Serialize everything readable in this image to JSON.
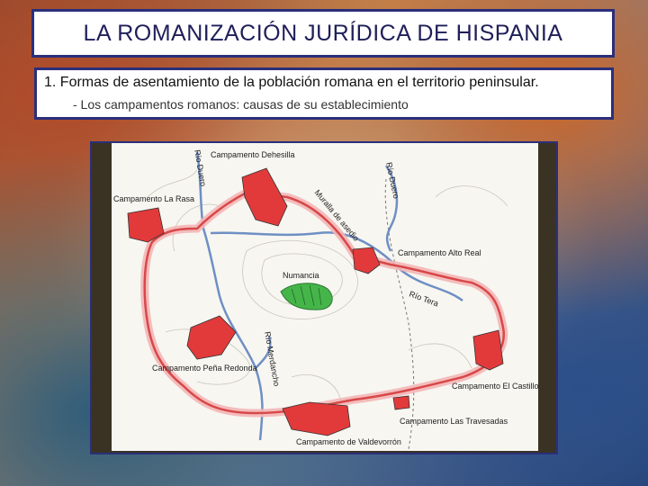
{
  "slide": {
    "title": "LA ROMANIZACIÓN JURÍDICA DE HISPANIA",
    "point1": "1. Formas de asentamiento de la población romana en el territorio peninsular.",
    "subpoint": "- Los campamentos romanos: causas de su establecimiento"
  },
  "map": {
    "labels": {
      "dehesilla": "Campamento Dehesilla",
      "la_rasa": "Campamento La Rasa",
      "alto_real": "Campamento Alto Real",
      "pena_redonda": "Campamento Peña Redonda",
      "el_castillo": "Campamento El Castillo",
      "travesadas": "Campamento Las Travesadas",
      "valdevorron": "Campamento de Valdevorrón",
      "numancia": "Numancia",
      "rio_duero_1": "Río Duero",
      "rio_duero_2": "Río Duero",
      "rio_tera": "Río Tera",
      "rio_merdancho": "Río Merdancho",
      "muralla": "Muralla de asedio"
    },
    "colors": {
      "camp": "#e23a3a",
      "wall": "#d84848",
      "river": "#6f8fc4",
      "numancia": "#45b54a"
    }
  }
}
